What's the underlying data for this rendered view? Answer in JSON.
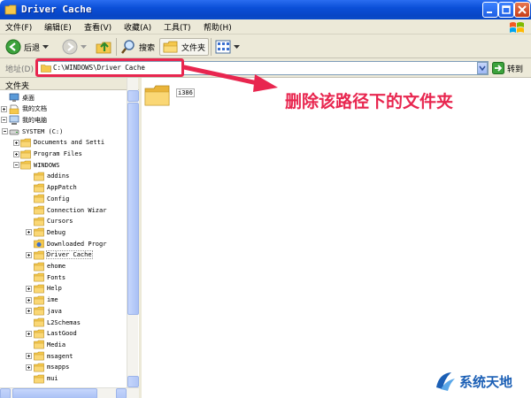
{
  "window": {
    "title": "Driver Cache",
    "colors": {
      "titlebar": "#0b4fd8",
      "chrome": "#ece9d8",
      "highlight": "#e8264f",
      "folder": "#f5c84c"
    }
  },
  "menu": {
    "items": [
      "文件(F)",
      "编辑(E)",
      "查看(V)",
      "收藏(A)",
      "工具(T)",
      "帮助(H)"
    ]
  },
  "toolbar": {
    "back_label": "后退",
    "search_label": "搜索",
    "folders_label": "文件夹"
  },
  "address": {
    "label": "地址(D)",
    "value": "C:\\WINDOWS\\Driver Cache",
    "go_label": "转到"
  },
  "folder_pane": {
    "title": "文件夹",
    "tree": [
      {
        "label": "桌面",
        "depth": 0,
        "icon": "desktop-icon",
        "expander": "none"
      },
      {
        "label": "我的文档",
        "depth": 1,
        "icon": "my-documents-icon",
        "expander": "plus"
      },
      {
        "label": "我的电脑",
        "depth": 1,
        "icon": "my-computer-icon",
        "expander": "minus"
      },
      {
        "label": "SYSTEM (C:)",
        "depth": 2,
        "icon": "drive-icon",
        "expander": "minus"
      },
      {
        "label": "Documents and Setti",
        "depth": 3,
        "icon": "folder-icon",
        "expander": "plus"
      },
      {
        "label": "Program Files",
        "depth": 3,
        "icon": "folder-icon",
        "expander": "plus"
      },
      {
        "label": "WINDOWS",
        "depth": 3,
        "icon": "folder-icon",
        "expander": "minus"
      },
      {
        "label": "addins",
        "depth": 4,
        "icon": "folder-icon",
        "expander": "none"
      },
      {
        "label": "AppPatch",
        "depth": 4,
        "icon": "folder-icon",
        "expander": "none"
      },
      {
        "label": "Config",
        "depth": 4,
        "icon": "folder-icon",
        "expander": "none"
      },
      {
        "label": "Connection Wizar",
        "depth": 4,
        "icon": "folder-icon",
        "expander": "none"
      },
      {
        "label": "Cursors",
        "depth": 4,
        "icon": "folder-icon",
        "expander": "none"
      },
      {
        "label": "Debug",
        "depth": 4,
        "icon": "folder-icon",
        "expander": "plus"
      },
      {
        "label": "Downloaded Progr",
        "depth": 4,
        "icon": "folder-special-icon",
        "expander": "none"
      },
      {
        "label": "Driver Cache",
        "depth": 4,
        "icon": "folder-icon",
        "expander": "plus",
        "selected": true
      },
      {
        "label": "ehome",
        "depth": 4,
        "icon": "folder-icon",
        "expander": "none"
      },
      {
        "label": "Fonts",
        "depth": 4,
        "icon": "folder-icon",
        "expander": "none"
      },
      {
        "label": "Help",
        "depth": 4,
        "icon": "folder-icon",
        "expander": "plus"
      },
      {
        "label": "ime",
        "depth": 4,
        "icon": "folder-icon",
        "expander": "plus"
      },
      {
        "label": "java",
        "depth": 4,
        "icon": "folder-icon",
        "expander": "plus"
      },
      {
        "label": "L2Schemas",
        "depth": 4,
        "icon": "folder-icon",
        "expander": "none"
      },
      {
        "label": "LastGood",
        "depth": 4,
        "icon": "folder-icon",
        "expander": "plus"
      },
      {
        "label": "Media",
        "depth": 4,
        "icon": "folder-icon",
        "expander": "none"
      },
      {
        "label": "msagent",
        "depth": 4,
        "icon": "folder-icon",
        "expander": "plus"
      },
      {
        "label": "msapps",
        "depth": 4,
        "icon": "folder-icon",
        "expander": "plus"
      },
      {
        "label": "mui",
        "depth": 4,
        "icon": "folder-icon",
        "expander": "none"
      }
    ]
  },
  "content": {
    "items": [
      {
        "label": "i386",
        "icon": "folder-icon"
      }
    ]
  },
  "annotation": {
    "text": "删除该路径下的文件夹"
  },
  "watermark": {
    "text": "系统天地"
  }
}
